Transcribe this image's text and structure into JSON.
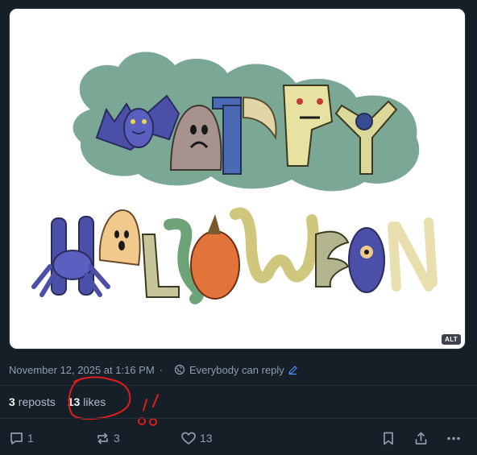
{
  "image": {
    "alt_badge": "ALT"
  },
  "post": {
    "timestamp": "November 12, 2025 at 1:16 PM",
    "separator": "·",
    "reply_setting": "Everybody can reply"
  },
  "stats": {
    "reposts_count": "3",
    "reposts_label": "reposts",
    "likes_count": "13",
    "likes_label": "likes"
  },
  "actions": {
    "reply_count": "1",
    "repost_count": "3",
    "like_count": "13"
  },
  "colors": {
    "background": "#161e27",
    "muted_text": "#8d9eb0",
    "annotation_red": "#e01d1d"
  }
}
